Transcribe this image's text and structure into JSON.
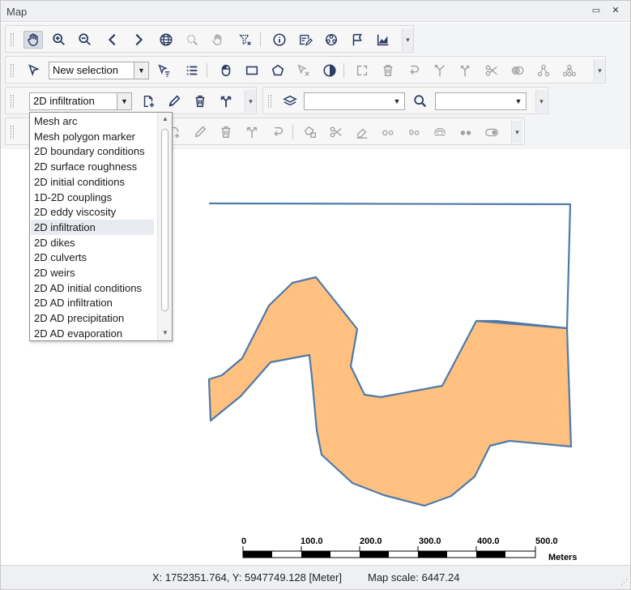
{
  "window": {
    "title": "Map",
    "restore_glyph": "▭",
    "close_glyph": "✕"
  },
  "toolbar1": {
    "icons": [
      "pan-hand-icon",
      "zoom-in-icon",
      "zoom-out-icon",
      "previous-extent-icon",
      "next-extent-icon",
      "globe-icon",
      "zoom-to-selection-icon",
      "pan-to-selection-icon",
      "clear-selection-icon",
      "info-icon",
      "edit-form-icon",
      "network-icon",
      "flag-icon",
      "chart-icon"
    ]
  },
  "toolbar2": {
    "selection_select": "New selection",
    "icons": [
      "select-arrow-icon",
      "filter-select-icon",
      "list-icon",
      "mouse-icon",
      "rectangle-icon",
      "polygon-icon",
      "deselect-arrow-icon",
      "invert-selection-icon",
      "copy-selection-icon",
      "delete-icon",
      "undo-icon",
      "merge-icon",
      "split-icon",
      "cut-scissors-icon",
      "overlay-icon",
      "node-icon",
      "tree-icon"
    ]
  },
  "toolbar3": {
    "layer_select": "2D infiltration",
    "layers_select": "",
    "search_select": ""
  },
  "dropdown": {
    "items": [
      "Mesh arc",
      "Mesh polygon marker",
      "2D boundary conditions",
      "2D surface roughness",
      "2D initial conditions",
      "1D-2D couplings",
      "2D eddy viscosity",
      "2D infiltration",
      "2D dikes",
      "2D culverts",
      "2D weirs",
      "2D AD initial conditions",
      "2D AD infiltration",
      "2D AD precipitation",
      "2D AD evaporation"
    ],
    "selected": "2D infiltration"
  },
  "map": {
    "fill_color": "#ffc080",
    "stroke_color": "#4f7aa8",
    "scalebar": {
      "labels": [
        "0",
        "100.0",
        "200.0",
        "300.0",
        "400.0",
        "500.0"
      ],
      "unit": "Meters"
    }
  },
  "status": {
    "coordinates": "X: 1752351.764, Y: 5947749.128 [Meter]",
    "map_scale": "Map scale: 6447.24"
  }
}
